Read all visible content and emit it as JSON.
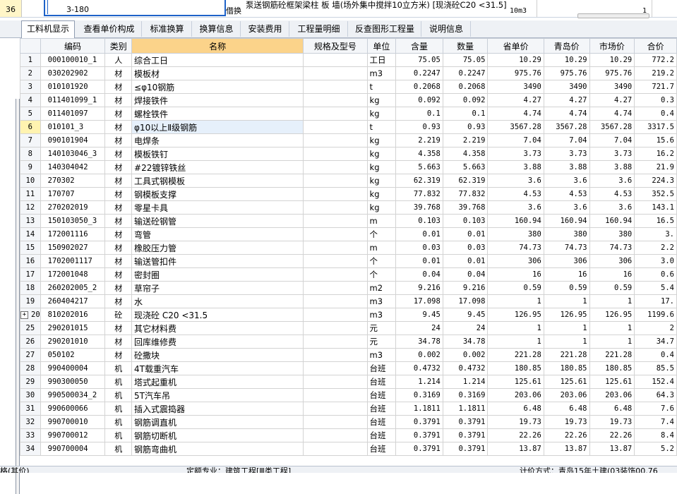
{
  "top_row": {
    "row_number": "36",
    "code": "3-180",
    "type": "借换",
    "name": "泵送钢筋砼框架梁柱 板 墙(场外集中搅拌10立方米) [现浇砼C20 <31.5]",
    "unit": "10m3",
    "quantity": "1"
  },
  "tabs": [
    {
      "label": "工料机显示",
      "active": true
    },
    {
      "label": "查看单价构成",
      "active": false
    },
    {
      "label": "标准换算",
      "active": false
    },
    {
      "label": "换算信息",
      "active": false
    },
    {
      "label": "安装费用",
      "active": false
    },
    {
      "label": "工程量明细",
      "active": false
    },
    {
      "label": "反查图形工程量",
      "active": false
    },
    {
      "label": "说明信息",
      "active": false
    }
  ],
  "columns": [
    "编码",
    "类别",
    "名称",
    "规格及型号",
    "单位",
    "含量",
    "数量",
    "省单价",
    "青岛价",
    "市场价",
    "合价"
  ],
  "rows": [
    {
      "no": "1",
      "code": "000100010_1",
      "cat": "人",
      "name": "综合工日",
      "unit": "工日",
      "content": "75.05",
      "qty": "75.05",
      "prov": "10.29",
      "qd": "10.29",
      "market": "10.29",
      "total": "772.2"
    },
    {
      "no": "2",
      "code": "030202902",
      "cat": "材",
      "name": "模板材",
      "unit": "m3",
      "content": "0.2247",
      "qty": "0.2247",
      "prov": "975.76",
      "qd": "975.76",
      "market": "975.76",
      "total": "219.2"
    },
    {
      "no": "3",
      "code": "010101920",
      "cat": "材",
      "name": "≤φ10钢筋",
      "unit": "t",
      "content": "0.2068",
      "qty": "0.2068",
      "prov": "3490",
      "qd": "3490",
      "market": "3490",
      "total": "721.7"
    },
    {
      "no": "4",
      "code": "011401099_1",
      "cat": "材",
      "name": "焊接铁件",
      "unit": "kg",
      "content": "0.092",
      "qty": "0.092",
      "prov": "4.27",
      "qd": "4.27",
      "market": "4.27",
      "total": "0.3"
    },
    {
      "no": "5",
      "code": "011401097",
      "cat": "材",
      "name": "螺栓铁件",
      "unit": "kg",
      "content": "0.1",
      "qty": "0.1",
      "prov": "4.74",
      "qd": "4.74",
      "market": "4.74",
      "total": "0.4"
    },
    {
      "no": "6",
      "code": "010101_3",
      "cat": "材",
      "name": "φ10以上Ⅱ级钢筋",
      "unit": "t",
      "content": "0.93",
      "qty": "0.93",
      "prov": "3567.28",
      "qd": "3567.28",
      "market": "3567.28",
      "total": "3317.5",
      "selected": true
    },
    {
      "no": "7",
      "code": "090101904",
      "cat": "材",
      "name": "电焊条",
      "unit": "kg",
      "content": "2.219",
      "qty": "2.219",
      "prov": "7.04",
      "qd": "7.04",
      "market": "7.04",
      "total": "15.6"
    },
    {
      "no": "8",
      "code": "140103046_3",
      "cat": "材",
      "name": "模板铁钉",
      "unit": "kg",
      "content": "4.358",
      "qty": "4.358",
      "prov": "3.73",
      "qd": "3.73",
      "market": "3.73",
      "total": "16.2"
    },
    {
      "no": "9",
      "code": "140304042",
      "cat": "材",
      "name": "#22镀锌铁丝",
      "unit": "kg",
      "content": "5.663",
      "qty": "5.663",
      "prov": "3.88",
      "qd": "3.88",
      "market": "3.88",
      "total": "21.9"
    },
    {
      "no": "10",
      "code": "270302",
      "cat": "材",
      "name": "工具式钢模板",
      "unit": "kg",
      "content": "62.319",
      "qty": "62.319",
      "prov": "3.6",
      "qd": "3.6",
      "market": "3.6",
      "total": "224.3"
    },
    {
      "no": "11",
      "code": "170707",
      "cat": "材",
      "name": "钢模板支撑",
      "unit": "kg",
      "content": "77.832",
      "qty": "77.832",
      "prov": "4.53",
      "qd": "4.53",
      "market": "4.53",
      "total": "352.5"
    },
    {
      "no": "12",
      "code": "270202019",
      "cat": "材",
      "name": "零星卡具",
      "unit": "kg",
      "content": "39.768",
      "qty": "39.768",
      "prov": "3.6",
      "qd": "3.6",
      "market": "3.6",
      "total": "143.1"
    },
    {
      "no": "13",
      "code": "150103050_3",
      "cat": "材",
      "name": "输送砼钢管",
      "unit": "m",
      "content": "0.103",
      "qty": "0.103",
      "prov": "160.94",
      "qd": "160.94",
      "market": "160.94",
      "total": "16.5"
    },
    {
      "no": "14",
      "code": "172001116",
      "cat": "材",
      "name": "弯管",
      "unit": "个",
      "content": "0.01",
      "qty": "0.01",
      "prov": "380",
      "qd": "380",
      "market": "380",
      "total": "3."
    },
    {
      "no": "15",
      "code": "150902027",
      "cat": "材",
      "name": "橡胶压力管",
      "unit": "m",
      "content": "0.03",
      "qty": "0.03",
      "prov": "74.73",
      "qd": "74.73",
      "market": "74.73",
      "total": "2.2"
    },
    {
      "no": "16",
      "code": "1702001117",
      "cat": "材",
      "name": "输送管扣件",
      "unit": "个",
      "content": "0.01",
      "qty": "0.01",
      "prov": "306",
      "qd": "306",
      "market": "306",
      "total": "3.0"
    },
    {
      "no": "17",
      "code": "172001048",
      "cat": "材",
      "name": "密封圈",
      "unit": "个",
      "content": "0.04",
      "qty": "0.04",
      "prov": "16",
      "qd": "16",
      "market": "16",
      "total": "0.6"
    },
    {
      "no": "18",
      "code": "260202005_2",
      "cat": "材",
      "name": "草帘子",
      "unit": "m2",
      "content": "9.216",
      "qty": "9.216",
      "prov": "0.59",
      "qd": "0.59",
      "market": "0.59",
      "total": "5.4"
    },
    {
      "no": "19",
      "code": "260404217",
      "cat": "材",
      "name": "水",
      "unit": "m3",
      "content": "17.098",
      "qty": "17.098",
      "prov": "1",
      "qd": "1",
      "market": "1",
      "total": "17."
    },
    {
      "no": "20",
      "code": "810202016",
      "cat": "砼",
      "name": "现浇砼 C20 <31.5",
      "unit": "m3",
      "content": "9.45",
      "qty": "9.45",
      "prov": "126.95",
      "qd": "126.95",
      "market": "126.95",
      "total": "1199.6",
      "expand": true
    },
    {
      "no": "25",
      "code": "290201015",
      "cat": "材",
      "name": "其它材料费",
      "unit": "元",
      "content": "24",
      "qty": "24",
      "prov": "1",
      "qd": "1",
      "market": "1",
      "total": "2"
    },
    {
      "no": "26",
      "code": "290201010",
      "cat": "材",
      "name": "回库维修费",
      "unit": "元",
      "content": "34.78",
      "qty": "34.78",
      "prov": "1",
      "qd": "1",
      "market": "1",
      "total": "34.7"
    },
    {
      "no": "27",
      "code": "050102",
      "cat": "材",
      "name": "砼撒块",
      "unit": "m3",
      "content": "0.002",
      "qty": "0.002",
      "prov": "221.28",
      "qd": "221.28",
      "market": "221.28",
      "total": "0.4"
    },
    {
      "no": "28",
      "code": "990400004",
      "cat": "机",
      "name": "4T载重汽车",
      "unit": "台班",
      "content": "0.4732",
      "qty": "0.4732",
      "prov": "180.85",
      "qd": "180.85",
      "market": "180.85",
      "total": "85.5"
    },
    {
      "no": "29",
      "code": "990300050",
      "cat": "机",
      "name": "塔式起重机",
      "unit": "台班",
      "content": "1.214",
      "qty": "1.214",
      "prov": "125.61",
      "qd": "125.61",
      "market": "125.61",
      "total": "152.4"
    },
    {
      "no": "30",
      "code": "990500034_2",
      "cat": "机",
      "name": "5T汽车吊",
      "unit": "台班",
      "content": "0.3169",
      "qty": "0.3169",
      "prov": "203.06",
      "qd": "203.06",
      "market": "203.06",
      "total": "64.3"
    },
    {
      "no": "31",
      "code": "990600066",
      "cat": "机",
      "name": "插入式震捣器",
      "unit": "台班",
      "content": "1.1811",
      "qty": "1.1811",
      "prov": "6.48",
      "qd": "6.48",
      "market": "6.48",
      "total": "7.6"
    },
    {
      "no": "32",
      "code": "990700010",
      "cat": "机",
      "name": "钢筋调直机",
      "unit": "台班",
      "content": "0.3791",
      "qty": "0.3791",
      "prov": "19.73",
      "qd": "19.73",
      "market": "19.73",
      "total": "7.4"
    },
    {
      "no": "33",
      "code": "990700012",
      "cat": "机",
      "name": "钢筋切断机",
      "unit": "台班",
      "content": "0.3791",
      "qty": "0.3791",
      "prov": "22.26",
      "qd": "22.26",
      "market": "22.26",
      "total": "8.4"
    },
    {
      "no": "34",
      "code": "990700004",
      "cat": "机",
      "name": "钢筋弯曲机",
      "unit": "台班",
      "content": "0.3791",
      "qty": "0.3791",
      "prov": "13.87",
      "qd": "13.87",
      "market": "13.87",
      "total": "5.2"
    }
  ],
  "statusbar": {
    "left": "格(其价)",
    "middle": "定额专业：建筑工程[Ⅲ类工程]",
    "right": "计价方式：青岛15年土建(03装饰00.76"
  },
  "colors": {
    "accent": "#1e62c8",
    "header_highlight": "#fbd38a",
    "selected_row": "#e6f0fb"
  }
}
